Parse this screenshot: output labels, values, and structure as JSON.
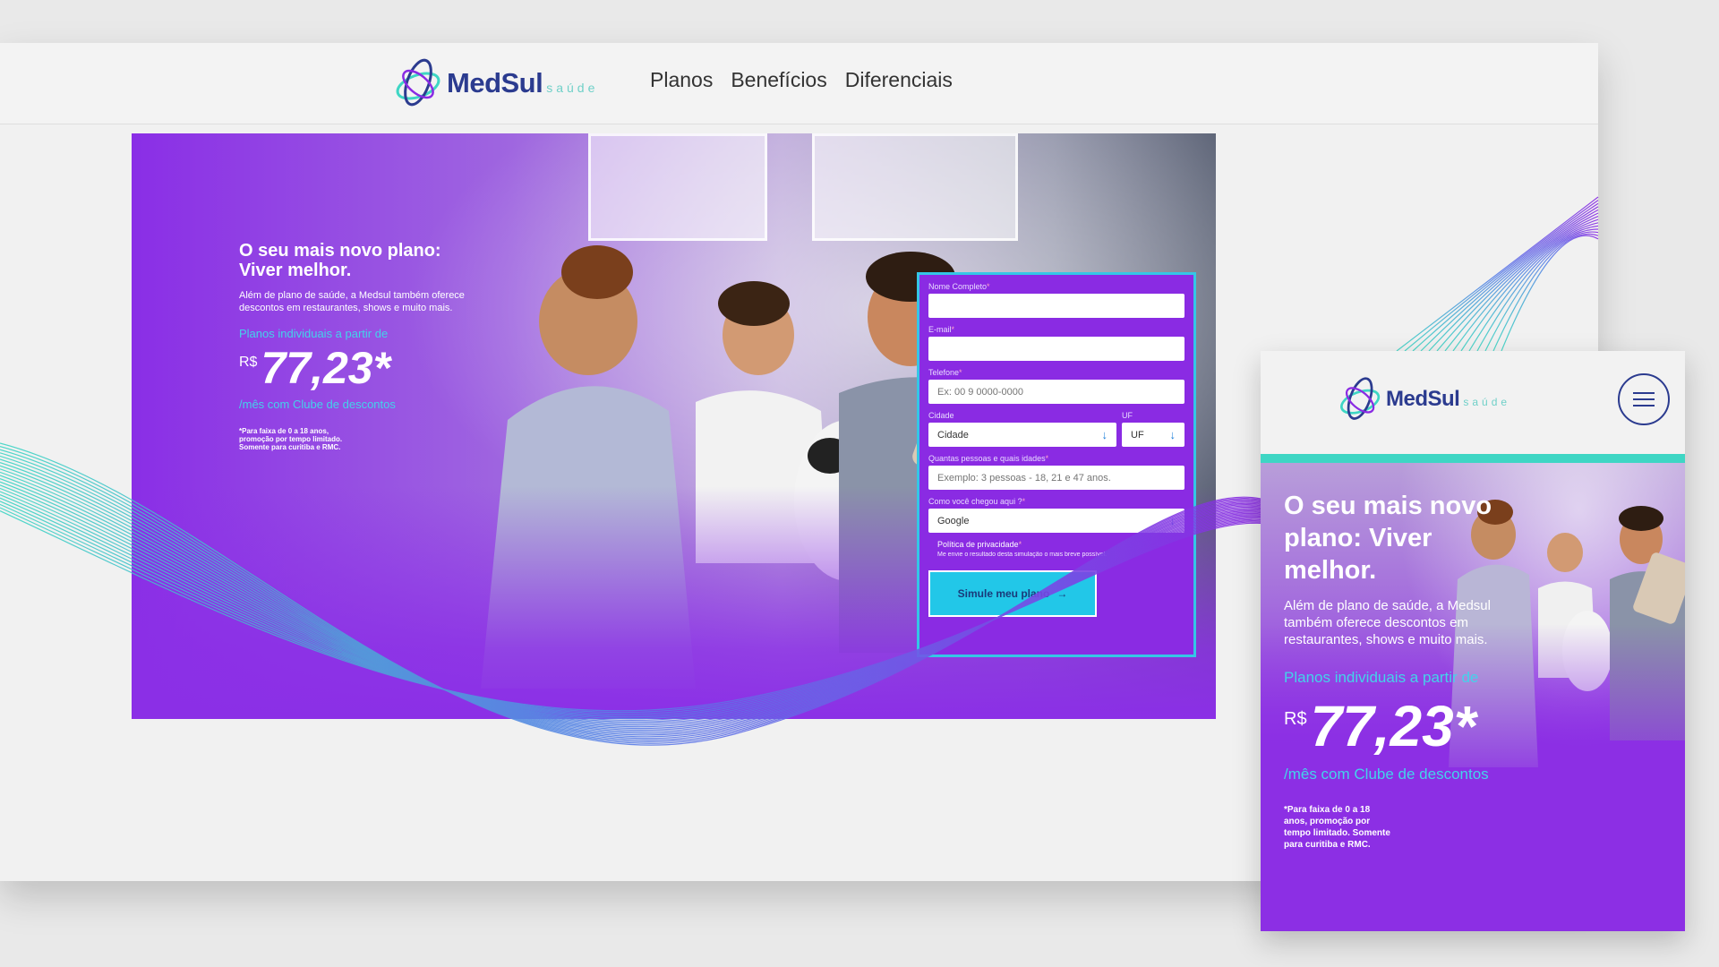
{
  "brand": {
    "name": "MedSul",
    "sub": "saúde"
  },
  "nav": {
    "items": [
      "Planos",
      "Benefícios",
      "Diferenciais"
    ]
  },
  "hero": {
    "title_line1": "O seu mais novo plano:",
    "title_line2": "Viver melhor.",
    "description": "Além de plano de saúde, a Medsul também oferece descontos em restaurantes, shows e muito mais.",
    "from_text": "Planos individuais a partir de",
    "currency": "R$",
    "price": "77,23*",
    "per_month": "/mês com Clube de descontos",
    "note": "*Para faixa de 0 a 18 anos, promoção por tempo limitado. Somente para curitiba e RMC."
  },
  "form": {
    "name_label": "Nome Completo",
    "email_label": "E-mail",
    "phone_label": "Telefone",
    "phone_placeholder": "Ex: 00 9 0000-0000",
    "city_label": "Cidade",
    "city_value": "Cidade",
    "uf_label": "UF",
    "uf_value": "UF",
    "people_label": "Quantas pessoas e quais idades",
    "people_placeholder": "Exemplo: 3 pessoas - 18, 21 e 47 anos.",
    "source_label": "Como você chegou aqui ?",
    "source_value": "Google",
    "privacy_title": "Política de privacidade",
    "privacy_text": "Me envie o resultado desta simulação o mais breve possível.",
    "required_mark": "*",
    "submit_label": "Simule meu plano",
    "arrow": "→",
    "select_arrow": "↓"
  },
  "mobile": {
    "title": "O seu mais novo plano: Viver melhor.",
    "description": "Além de plano de saúde, a Medsul também oferece descontos em restaurantes, shows e muito mais.",
    "from_text": "Planos individuais a partir de",
    "currency": "R$",
    "price": "77,23*",
    "per_month": "/mês com Clube de descontos",
    "note": "*Para faixa de 0 a 18 anos, promoção por tempo limitado. Somente para curitiba e RMC."
  },
  "colors": {
    "brand_purple": "#8a2be3",
    "brand_navy": "#2b3b8f",
    "accent_cyan": "#22c7e8",
    "accent_teal": "#3ed6c4"
  }
}
